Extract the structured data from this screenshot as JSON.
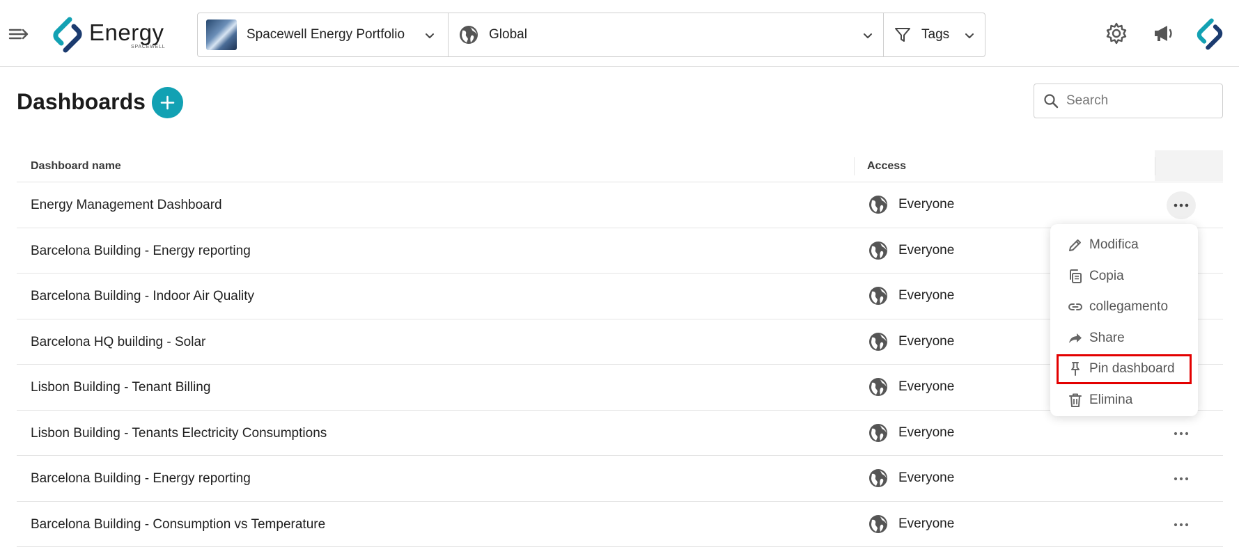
{
  "app": {
    "logo_text": "Energy",
    "logo_subtext": "SPACEWELL"
  },
  "header": {
    "portfolio_label": "Spacewell Energy Portfolio",
    "region_label": "Global",
    "tags_label": "Tags"
  },
  "page": {
    "title": "Dashboards",
    "search_placeholder": "Search"
  },
  "table": {
    "columns": [
      "Dashboard name",
      "Access"
    ],
    "rows": [
      {
        "name": "Energy Management Dashboard",
        "access": "Everyone"
      },
      {
        "name": "Barcelona Building - Energy reporting",
        "access": "Everyone"
      },
      {
        "name": "Barcelona Building - Indoor Air Quality",
        "access": "Everyone"
      },
      {
        "name": "Barcelona HQ building - Solar",
        "access": "Everyone"
      },
      {
        "name": "Lisbon Building - Tenant Billing",
        "access": "Everyone"
      },
      {
        "name": "Lisbon Building - Tenants Electricity Consumptions",
        "access": "Everyone"
      },
      {
        "name": "Barcelona Building - Energy reporting",
        "access": "Everyone"
      },
      {
        "name": "Barcelona Building - Consumption vs Temperature",
        "access": "Everyone"
      }
    ]
  },
  "context_menu": {
    "items": [
      {
        "label": "Modifica",
        "icon": "pencil-icon"
      },
      {
        "label": "Copia",
        "icon": "copy-icon"
      },
      {
        "label": "collegamento",
        "icon": "link-icon"
      },
      {
        "label": "Share",
        "icon": "share-icon"
      },
      {
        "label": "Pin dashboard",
        "icon": "pin-icon",
        "highlighted": true
      },
      {
        "label": "Elimina",
        "icon": "trash-icon"
      }
    ]
  },
  "colors": {
    "accent": "#12a1b3",
    "highlight_border": "#e30000",
    "logo_dark": "#1b3b6f",
    "logo_teal": "#12a1b3"
  }
}
